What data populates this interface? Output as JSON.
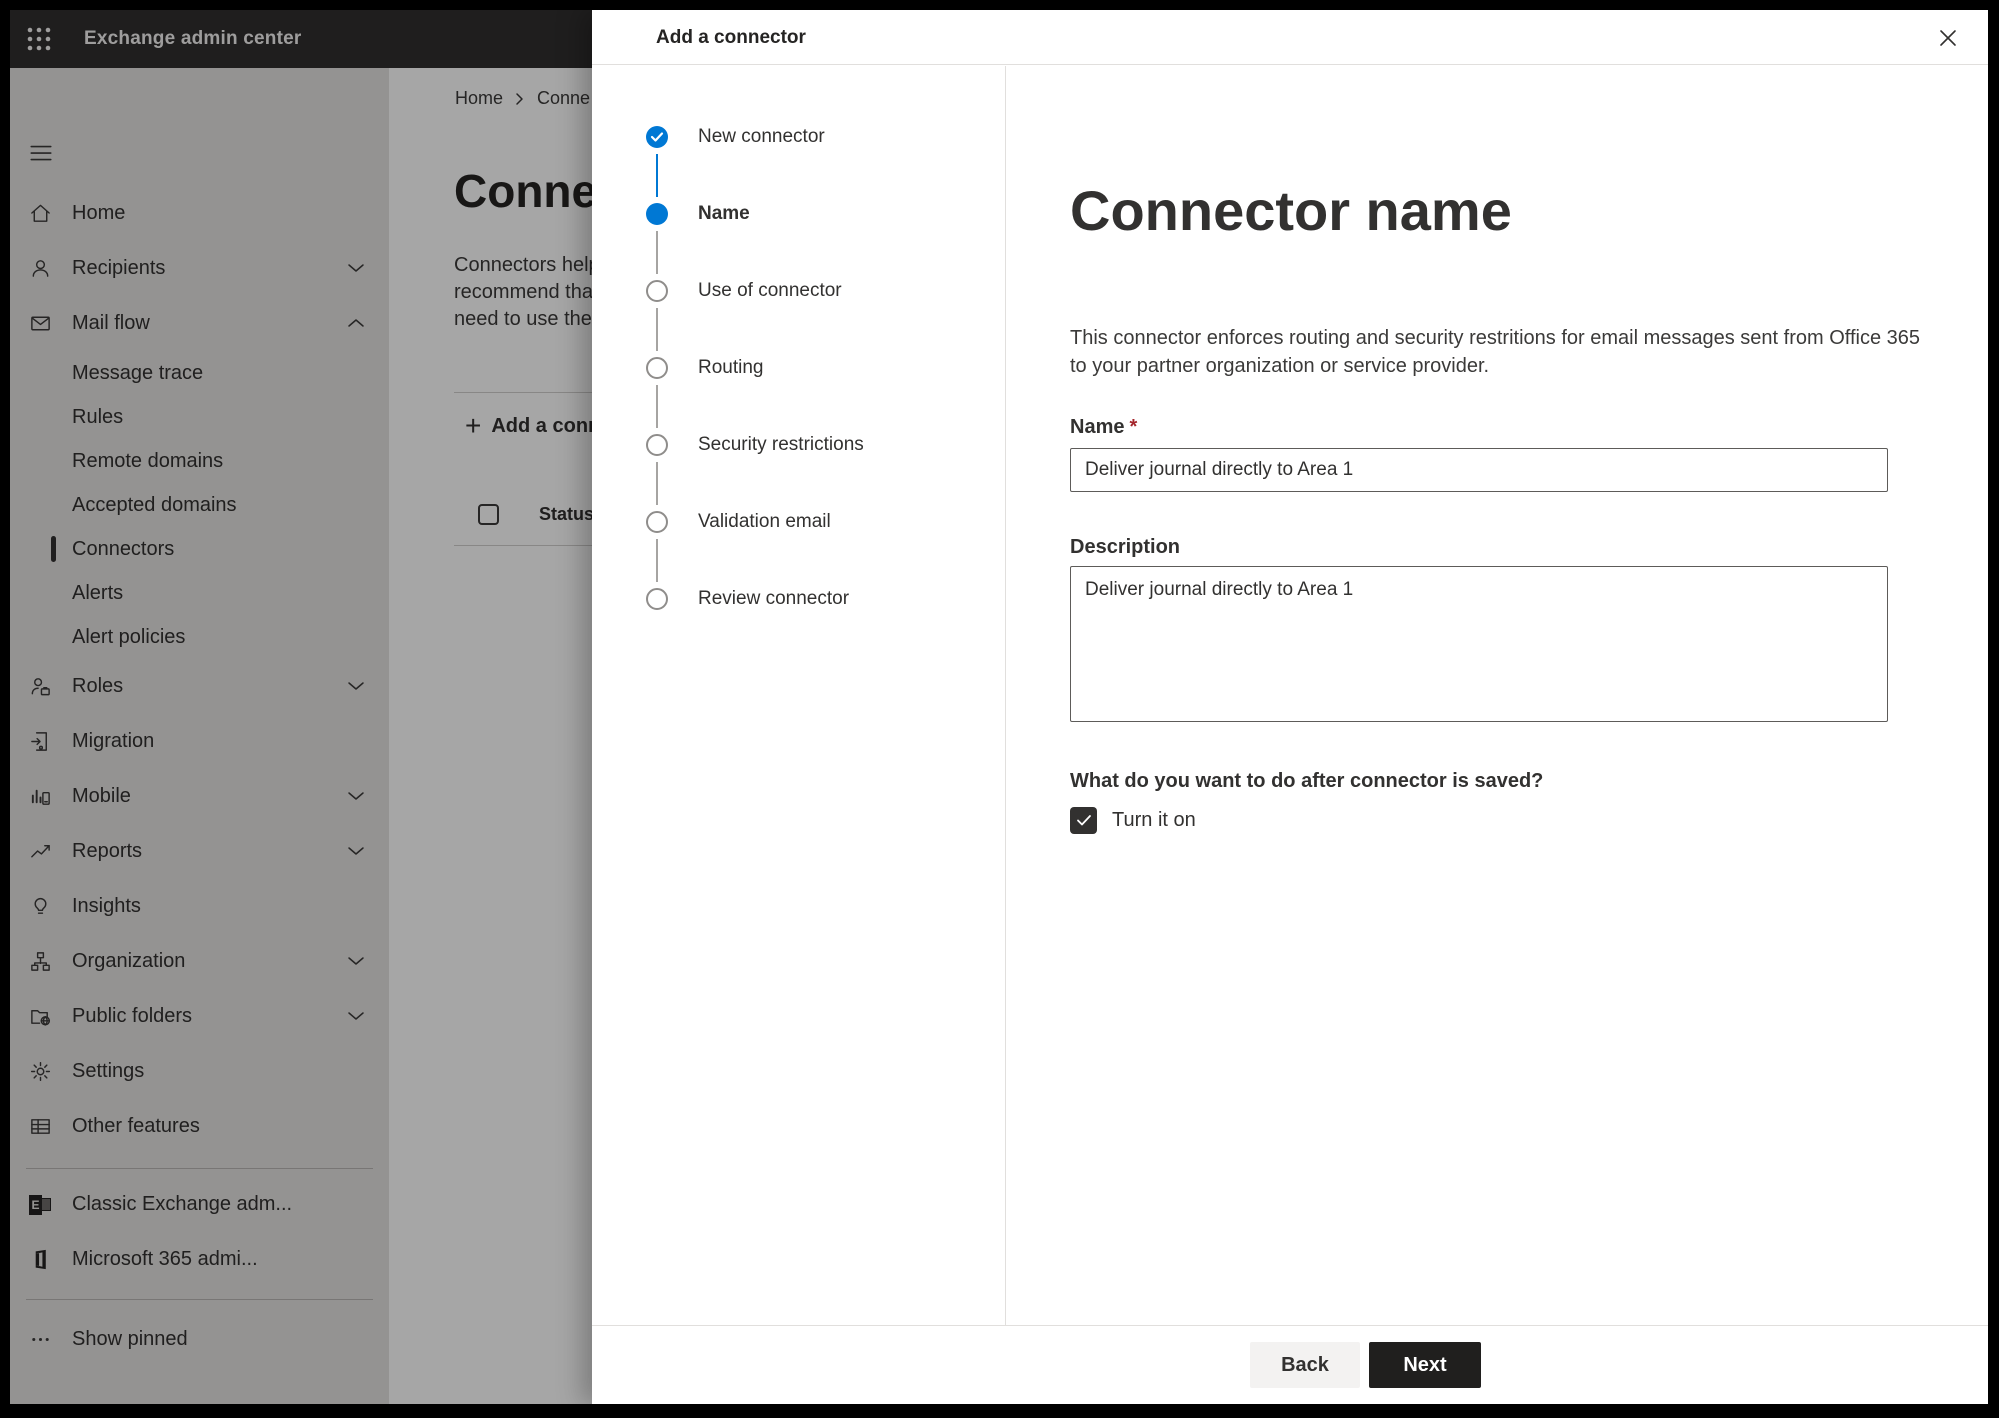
{
  "topbar": {
    "title": "Exchange admin center"
  },
  "sidebar": {
    "items": [
      {
        "label": "Home",
        "icon": "home-icon"
      },
      {
        "label": "Recipients",
        "icon": "person-icon"
      },
      {
        "label": "Mail flow",
        "icon": "envelope-icon"
      },
      {
        "label": "Message trace"
      },
      {
        "label": "Rules"
      },
      {
        "label": "Remote domains"
      },
      {
        "label": "Accepted domains"
      },
      {
        "label": "Connectors",
        "selected": true
      },
      {
        "label": "Alerts"
      },
      {
        "label": "Alert policies"
      },
      {
        "label": "Roles",
        "icon": "person-badge-icon"
      },
      {
        "label": "Migration",
        "icon": "document-arrow-icon"
      },
      {
        "label": "Mobile",
        "icon": "mobile-chart-icon"
      },
      {
        "label": "Reports",
        "icon": "line-chart-icon"
      },
      {
        "label": "Insights",
        "icon": "lightbulb-icon"
      },
      {
        "label": "Organization",
        "icon": "org-chart-icon"
      },
      {
        "label": "Public folders",
        "icon": "folder-globe-icon"
      },
      {
        "label": "Settings",
        "icon": "gear-icon"
      },
      {
        "label": "Other features",
        "icon": "table-icon"
      },
      {
        "label": "Classic Exchange adm...",
        "icon": "exchange-logo-icon"
      },
      {
        "label": "Microsoft 365 admi...",
        "icon": "office-logo-icon"
      },
      {
        "label": "Show pinned",
        "icon": "ellipsis-icon"
      }
    ]
  },
  "page": {
    "breadcrumb": {
      "home": "Home",
      "current": "Conne"
    },
    "title": "Connec",
    "description_lines": [
      "Connectors help",
      "recommend that",
      "need to use ther"
    ],
    "add_button_label": "Add a conn",
    "table": {
      "status_header": "Status"
    }
  },
  "dialog": {
    "title": "Add a connector",
    "steps": [
      "New connector",
      "Name",
      "Use of connector",
      "Routing",
      "Security restrictions",
      "Validation email",
      "Review connector"
    ],
    "content": {
      "heading": "Connector name",
      "description_lines": [
        "This connector enforces routing and security restritions for email messages sent from Office 365",
        "to your partner organization or service provider."
      ],
      "name_label": "Name",
      "required_mark": "*",
      "name_value": "Deliver journal directly to Area 1",
      "description_label": "Description",
      "description_value": "Deliver journal directly to Area 1",
      "after_save_question": "What do you want to do after connector is saved?",
      "turn_on_label": "Turn it on"
    },
    "footer": {
      "back": "Back",
      "next": "Next"
    }
  },
  "colors": {
    "accent": "#0078d4",
    "next_button": "#201f1e",
    "required": "#a4262c"
  }
}
